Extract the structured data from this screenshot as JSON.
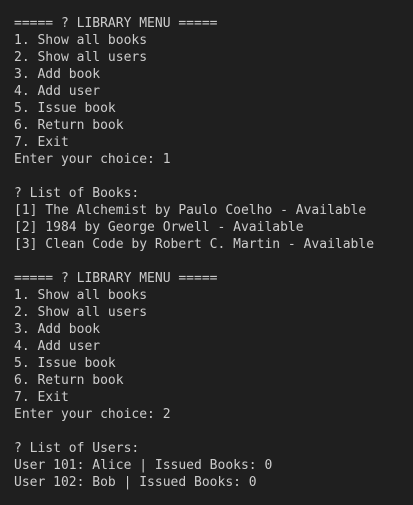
{
  "terminal": {
    "lines": [
      "===== ? LIBRARY MENU =====",
      "1. Show all books",
      "2. Show all users",
      "3. Add book",
      "4. Add user",
      "5. Issue book",
      "6. Return book",
      "7. Exit",
      "Enter your choice: 1",
      "",
      "? List of Books:",
      "[1] The Alchemist by Paulo Coelho - Available",
      "[2] 1984 by George Orwell - Available",
      "[3] Clean Code by Robert C. Martin - Available",
      "",
      "===== ? LIBRARY MENU =====",
      "1. Show all books",
      "2. Show all users",
      "3. Add book",
      "4. Add user",
      "5. Issue book",
      "6. Return book",
      "7. Exit",
      "Enter your choice: 2",
      "",
      "? List of Users:",
      "User 101: Alice | Issued Books: 0",
      "User 102: Bob | Issued Books: 0"
    ]
  }
}
